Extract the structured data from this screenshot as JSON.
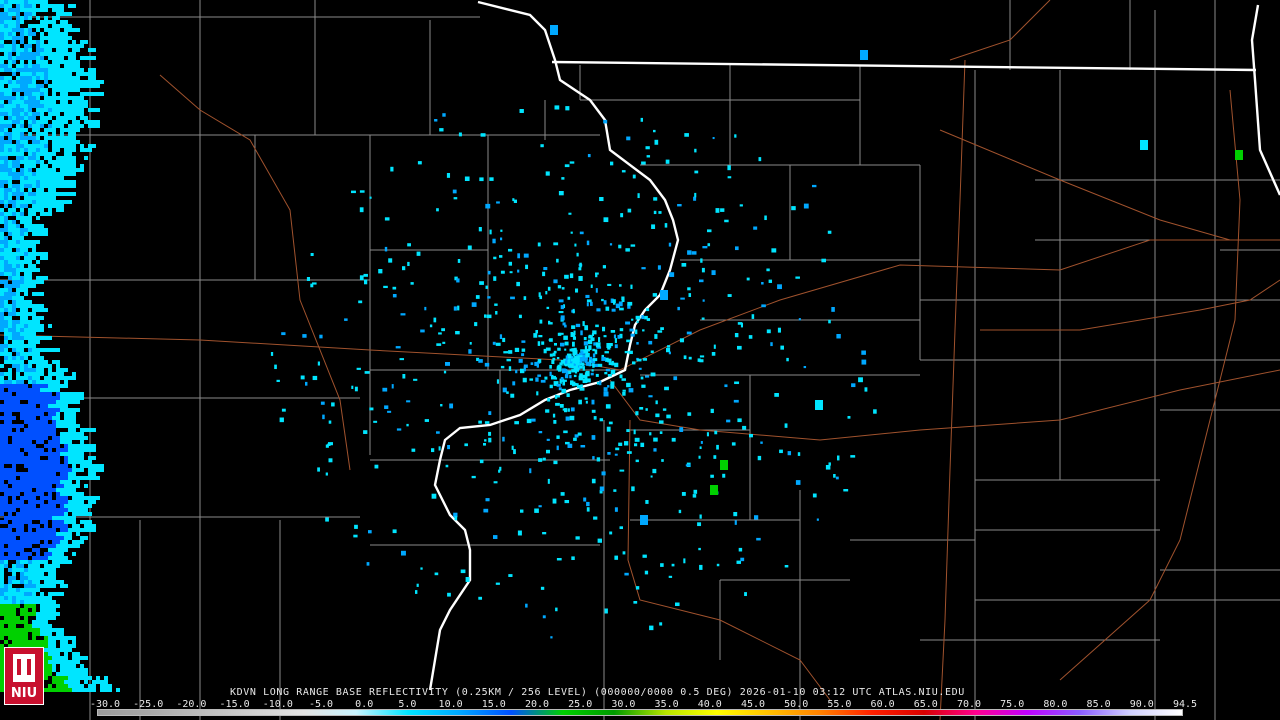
{
  "product": {
    "caption": "KDVN LONG RANGE BASE REFLECTIVITY (0.25KM / 256 LEVEL) (000000/0000 0.5 DEG) 2026-01-10 03:12 UTC  ATLAS.NIU.EDU"
  },
  "scale": {
    "labels": [
      "-30.0",
      "-25.0",
      "-20.0",
      "-15.0",
      "-10.0",
      "-5.0",
      "0.0",
      "5.0",
      "10.0",
      "15.0",
      "20.0",
      "25.0",
      "30.0",
      "35.0",
      "40.0",
      "45.0",
      "50.0",
      "55.0",
      "60.0",
      "65.0",
      "70.0",
      "75.0",
      "80.0",
      "85.0",
      "90.0",
      "94.5"
    ],
    "colors": [
      "#9a9a9a",
      "#a8a8a8",
      "#bcbcbc",
      "#d0d0d0",
      "#e2e2e2",
      "#c8f4ff",
      "#00e5ff",
      "#00a8ff",
      "#0050ff",
      "#00d000",
      "#009a00",
      "#b8e600",
      "#ffff00",
      "#ffc000",
      "#ff8000",
      "#ff2000",
      "#d80000",
      "#ff0090",
      "#c000ff",
      "#8a5cff",
      "#d0d0ff",
      "#ffffff"
    ]
  },
  "logo": {
    "text": "NIU"
  },
  "map": {
    "boundary_color": "#ffffff",
    "county_color": "#8a8a8a",
    "highway_color": "#a0522d",
    "echo_colors": [
      "#00e5ff",
      "#00a8ff",
      "#0050ff",
      "#00d000"
    ]
  }
}
